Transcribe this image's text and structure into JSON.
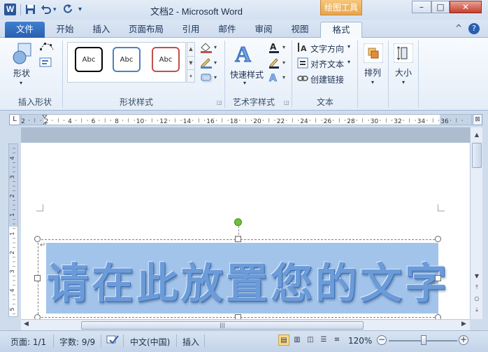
{
  "window": {
    "app_icon": "W",
    "title": "文档2 - Microsoft Word",
    "context_tab": "绘图工具",
    "minimize": "–",
    "maximize": "□",
    "close": "✕"
  },
  "qat": {
    "save_icon": "save-icon",
    "undo_icon": "undo-icon",
    "redo_icon": "redo-icon"
  },
  "tabs": {
    "file": "文件",
    "items": [
      "开始",
      "插入",
      "页面布局",
      "引用",
      "邮件",
      "审阅",
      "视图"
    ],
    "active": "格式",
    "help": "?",
    "collapse": "^"
  },
  "ribbon": {
    "insert_shapes": {
      "shape_label": "形状",
      "group_label": "插入形状"
    },
    "shape_styles": {
      "swatch_text": "Abc",
      "swatch_colors": [
        "#000000",
        "#4f81bd",
        "#c0504d"
      ],
      "group_label": "形状样式"
    },
    "wordart": {
      "quick_styles": "快速样式",
      "group_label": "艺术字样式"
    },
    "text": {
      "direction": "文字方向",
      "align": "对齐文本",
      "link": "创建链接",
      "group_label": "文本"
    },
    "arrange": {
      "label": "排列"
    },
    "size": {
      "label": "大小"
    }
  },
  "ruler": {
    "corner": "L",
    "h_marks": [
      "2",
      "2",
      "4",
      "6",
      "8",
      "10",
      "12",
      "14",
      "16",
      "18",
      "20",
      "22",
      "24",
      "26",
      "28",
      "30",
      "32",
      "34",
      "36"
    ],
    "v_marks": [
      "4",
      "3",
      "2",
      "1",
      "1",
      "2",
      "3",
      "4",
      "5"
    ]
  },
  "document": {
    "wordart_text": "请在此放置您的文字",
    "para_mark": "↵"
  },
  "status": {
    "page": "页面: 1/1",
    "words": "字数: 9/9",
    "language": "中文(中国)",
    "mode": "插入",
    "zoom": "120%",
    "zoom_minus": "−",
    "zoom_plus": "+"
  },
  "colors": {
    "accent": "#2a5fb0",
    "wordart_fill": "#a3c4ea",
    "context": "#e9a449"
  }
}
